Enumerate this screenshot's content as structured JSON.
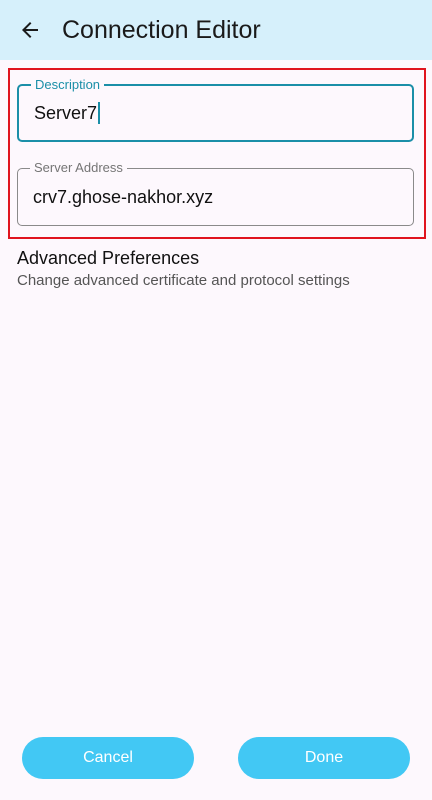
{
  "app_bar": {
    "title": "Connection Editor",
    "back_icon": "arrow-left-icon",
    "background": "#d6f0fb"
  },
  "form": {
    "description": {
      "label": "Description",
      "value": "Server7",
      "focused": true
    },
    "server_address": {
      "label": "Server Address",
      "value": "crv7.ghose-nakhor.xyz",
      "focused": false
    },
    "highlight_color": "#e0141e",
    "accent_color": "#1b8fa8"
  },
  "advanced": {
    "title": "Advanced Preferences",
    "subtitle": "Change advanced certificate and protocol settings"
  },
  "actions": {
    "cancel_label": "Cancel",
    "done_label": "Done",
    "button_color": "#42c8f4"
  }
}
